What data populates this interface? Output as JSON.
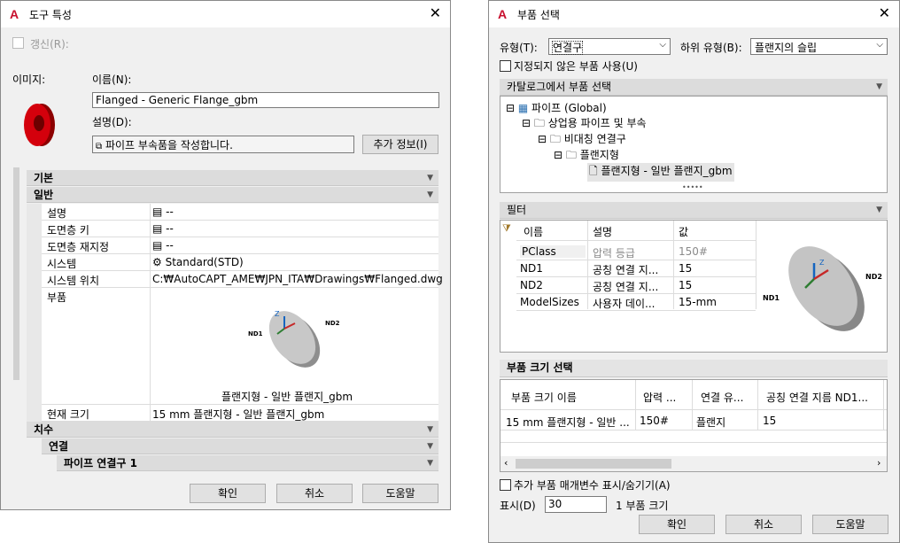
{
  "left": {
    "title": "도구 특성",
    "refresh": "갱신(R):",
    "image_label": "이미지:",
    "name_label": "이름(N):",
    "name_value": "Flanged - Generic Flange_gbm",
    "desc_label": "설명(D):",
    "desc_value": "파이프 부속품을 작성합니다.",
    "more_info": "추가 정보(I)",
    "sections": {
      "basic": "기본",
      "general": "일반",
      "dimension": "치수",
      "connection": "연결",
      "pipe_conn": "파이프 연결구 1"
    },
    "props": [
      {
        "k": "설명",
        "v": "--"
      },
      {
        "k": "도면층 키",
        "v": "--"
      },
      {
        "k": "도면층 재지정",
        "v": "--"
      },
      {
        "k": "시스템",
        "v": "Standard(STD)"
      },
      {
        "k": "시스템 위치",
        "v": "C:₩AutoCAPT_AME₩JPN_ITA₩Drawings₩Flanged.dwg"
      }
    ],
    "part_label": "부품",
    "part_caption": "플랜지형 - 일반 플랜지_gbm",
    "current_size_label": "현재 크기",
    "current_size_value": "15 mm 플랜지형 - 일반 플랜지_gbm",
    "buttons": {
      "ok": "확인",
      "cancel": "취소",
      "help": "도움말"
    }
  },
  "right": {
    "title": "부품 선택",
    "type_label": "유형(T):",
    "type_value": "연결구",
    "subtype_label": "하위 유형(B):",
    "subtype_value": "플랜지의 슬립",
    "unassigned": "지정되지 않은 부품 사용(U)",
    "catalog_header": "카탈로그에서 부품 선택",
    "tree": [
      "파이프 (Global)",
      "상업용 파이프 및 부속",
      "비대칭 연결구",
      "플랜지형",
      "플랜지형 - 일반 플랜지_gbm"
    ],
    "filter_header": "필터",
    "filter_cols": [
      "이름",
      "설명",
      "값"
    ],
    "filter_rows": [
      [
        "PClass",
        "압력 등급",
        "150#"
      ],
      [
        "ND1",
        "공칭 연결 지...",
        "15"
      ],
      [
        "ND2",
        "공칭 연결 지...",
        "15"
      ],
      [
        "ModelSizes",
        "사용자 데이...",
        "15-mm"
      ]
    ],
    "size_header": "부품 크기 선택",
    "size_cols": [
      "부품 크기 이름",
      "압력 ...",
      "연결 유...",
      "공칭 연결 지름 ND1..."
    ],
    "size_rows": [
      [
        "15 mm 플랜지형 - 일반 ...",
        "150#",
        "플랜지",
        "15"
      ]
    ],
    "show_params": "추가 부품 매개변수 표시/숨기기(A)",
    "display_label": "표시(D)",
    "display_value": "30",
    "size_count": "1 부품 크기",
    "buttons": {
      "ok": "확인",
      "cancel": "취소",
      "help": "도움말"
    }
  },
  "figure": {
    "nd1": "ND1",
    "nd2": "ND2",
    "z": "Z"
  },
  "colors": {
    "accent": "#c8102e",
    "flange": "#b5b5b5"
  }
}
